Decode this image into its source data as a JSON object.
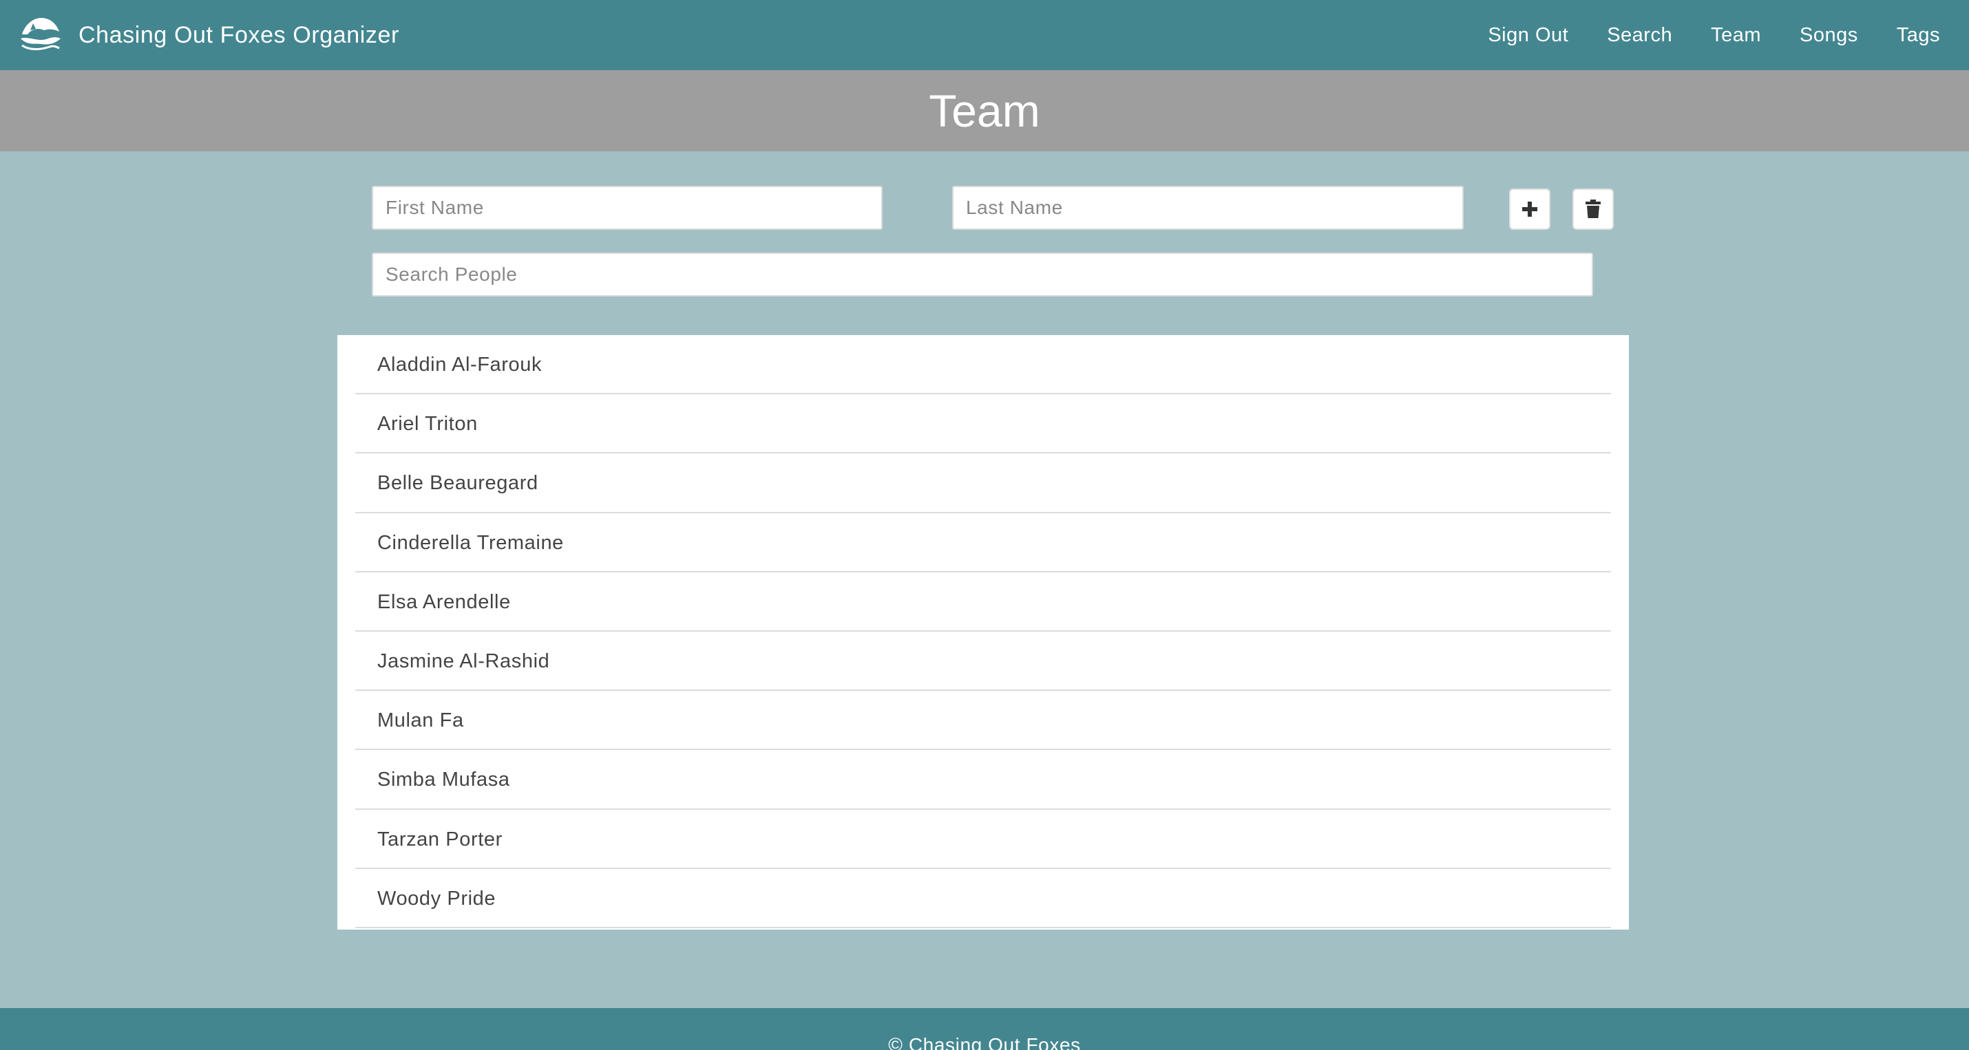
{
  "app": {
    "title": "Chasing Out Foxes Organizer",
    "logo_icon": "fox-boat-logo-icon"
  },
  "nav": {
    "items": [
      {
        "label": "Sign Out"
      },
      {
        "label": "Search"
      },
      {
        "label": "Team"
      },
      {
        "label": "Songs"
      },
      {
        "label": "Tags"
      }
    ]
  },
  "page": {
    "title": "Team"
  },
  "form": {
    "first_name_placeholder": "First Name",
    "last_name_placeholder": "Last Name",
    "search_placeholder": "Search People",
    "add_icon": "plus-icon",
    "delete_icon": "trash-icon"
  },
  "people": [
    {
      "name": "Aladdin Al-Farouk"
    },
    {
      "name": "Ariel Triton"
    },
    {
      "name": "Belle Beauregard"
    },
    {
      "name": "Cinderella Tremaine"
    },
    {
      "name": "Elsa Arendelle"
    },
    {
      "name": "Jasmine Al-Rashid"
    },
    {
      "name": "Mulan Fa"
    },
    {
      "name": "Simba Mufasa"
    },
    {
      "name": "Tarzan Porter"
    },
    {
      "name": "Woody Pride"
    }
  ],
  "footer": {
    "text": "© Chasing Out Foxes"
  },
  "colors": {
    "primary": "#438690",
    "background": "#a2bfc4",
    "header_band": "#9e9e9e"
  }
}
